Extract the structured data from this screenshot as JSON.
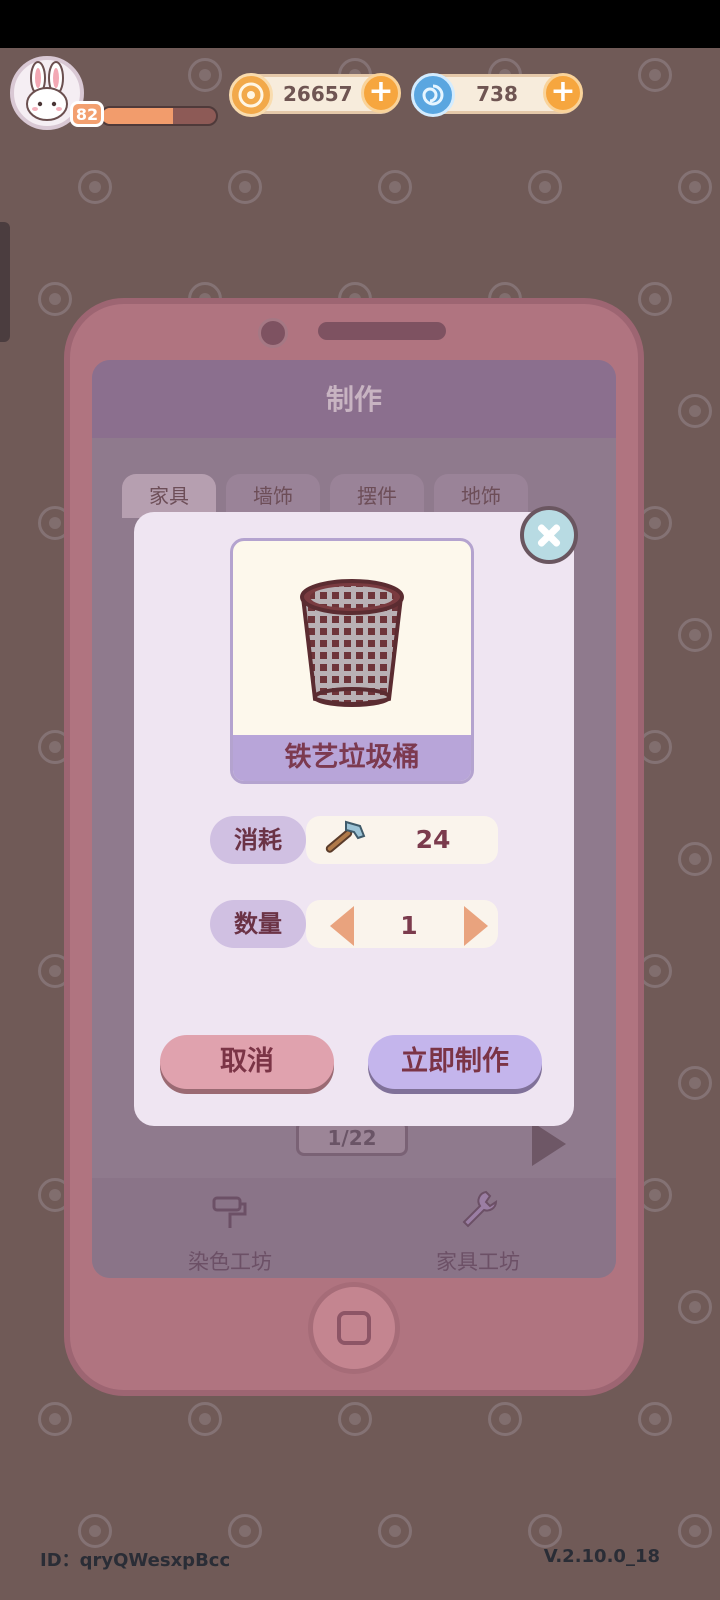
{
  "hud": {
    "level": "82",
    "xp_fraction": 0.62,
    "gold": "26657",
    "gems": "738",
    "gold_icon": "gold-coin-icon",
    "gem_icon": "blue-swirl-icon"
  },
  "craft_screen": {
    "title": "制作",
    "tabs": [
      "家具",
      "墙饰",
      "摆件",
      "地饰"
    ],
    "page_indicator": "1/22",
    "footer_items": [
      "染色工坊",
      "家具工坊"
    ]
  },
  "dialog": {
    "item_name": "铁艺垃圾桶",
    "cost_label": "消耗",
    "cost_value": "24",
    "cost_icon": "hammer-icon",
    "quantity_label": "数量",
    "quantity_value": "1",
    "cancel_label": "取消",
    "confirm_label": "立即制作"
  },
  "footer": {
    "id_text": "ID：qryQWesxpBcc",
    "version": "V.2.10.0_18"
  },
  "colors": {
    "accent_pink": "#b07480",
    "dialog_bg": "#efe5f2",
    "label_purple": "#d0c0e2",
    "text_maroon": "#7b3b4d"
  }
}
